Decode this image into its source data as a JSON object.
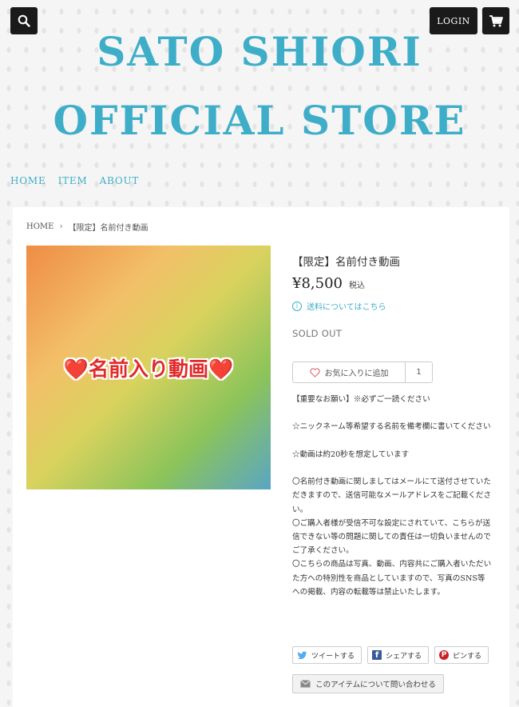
{
  "header": {
    "search_icon": "search-icon",
    "login_label": "LOGIN",
    "cart_icon": "cart-icon",
    "title_line1": "SATO SHIORI",
    "title_line2": "OFFICIAL STORE"
  },
  "nav": {
    "items": [
      {
        "label": "HOME"
      },
      {
        "label": "ITEM"
      },
      {
        "label": "ABOUT"
      }
    ]
  },
  "breadcrumb": {
    "home": "HOME",
    "separator": "›",
    "current": "【限定】名前付き動画"
  },
  "product": {
    "image_caption": "❤️名前入り動画❤️",
    "title": "【限定】名前付き動画",
    "price": "¥8,500",
    "tax_label": "税込",
    "shipping_link": "送料についてはこちら",
    "status": "SOLD OUT",
    "favorite_label": "お気に入りに追加",
    "favorite_count": "1",
    "description": [
      "【重要なお願い】※必ずご一読ください",
      "☆ニックネーム等希望する名前を備考欄に書いてください",
      "☆動画は約20秒を想定しています",
      "〇名前付き動画に関しましてはメールにて送付させていただきますので、送信可能なメールアドレスをご記載ください。",
      "〇ご購入者様が受信不可な設定にされていて、こちらが送信できない等の問題に関しての責任は一切負いませんのでご了承ください。",
      "〇こちらの商品は写真、動画、内容共にご購入者いただいた方への特別性を商品としていますので、写真のSNS等への掲載、内容の転載等は禁止いたします。"
    ]
  },
  "share": {
    "tweet_label": "ツイートする",
    "facebook_label": "シェアする",
    "pin_label": "ピンする",
    "facebook_glyph": "f",
    "pin_glyph": "P"
  },
  "contact": {
    "label": "このアイテムについて問い合わせる"
  },
  "colors": {
    "accent": "#3eaec8",
    "dark_button": "#1a1a1a",
    "heart": "#e22a2a"
  }
}
